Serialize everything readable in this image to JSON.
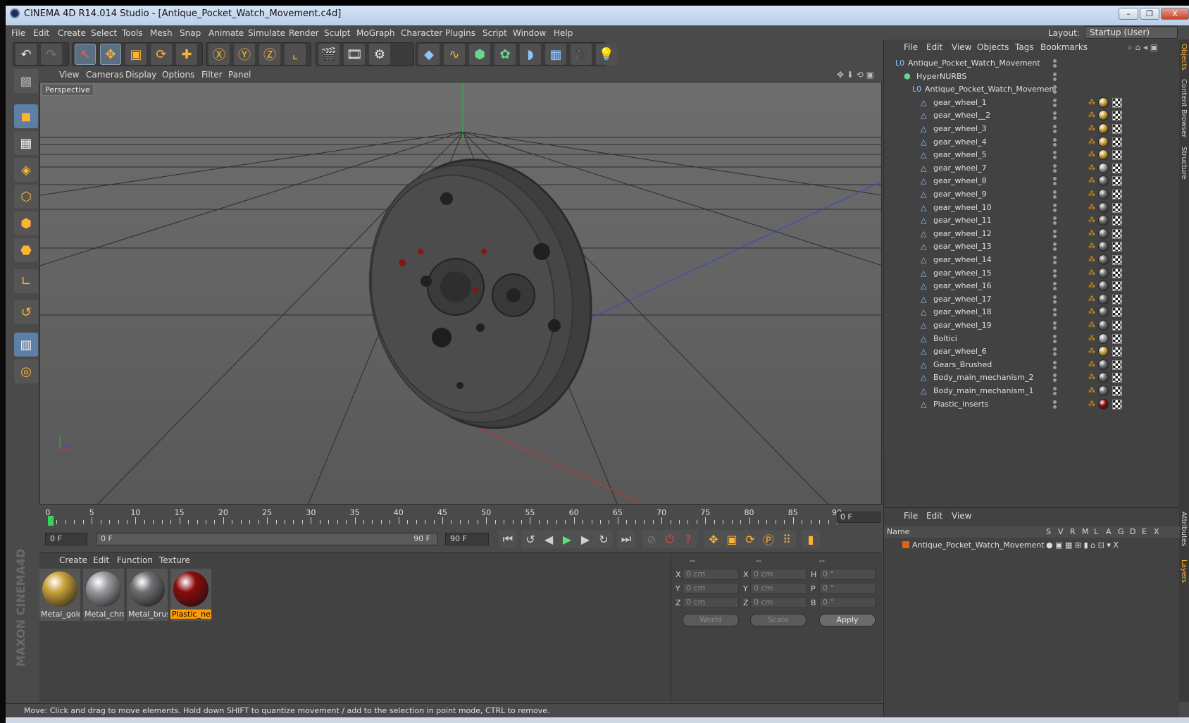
{
  "window": {
    "title": "CINEMA 4D R14.014 Studio - [Antique_Pocket_Watch_Movement.c4d]",
    "min": "–",
    "max": "❐",
    "close": "X"
  },
  "menu": [
    "File",
    "Edit",
    "Create",
    "Select",
    "Tools",
    "Mesh",
    "Snap",
    "Animate",
    "Simulate",
    "Render",
    "Sculpt",
    "MoGraph",
    "Character",
    "Plugins",
    "Script",
    "Window",
    "Help"
  ],
  "layout": {
    "label": "Layout:",
    "value": "Startup (User)"
  },
  "viewport": {
    "menu": [
      "View",
      "Cameras",
      "Display",
      "Options",
      "Filter",
      "Panel"
    ],
    "label": "Perspective"
  },
  "timeline": {
    "ticks": [
      "0",
      "5",
      "10",
      "15",
      "20",
      "25",
      "30",
      "35",
      "40",
      "45",
      "50",
      "55",
      "60",
      "65",
      "70",
      "75",
      "80",
      "85",
      "90"
    ],
    "current": "0 F"
  },
  "transport": {
    "start": "0 F",
    "range_start": "0 F",
    "range_end": "90 F",
    "end": "90 F"
  },
  "materials": {
    "menu": [
      "Create",
      "Edit",
      "Function",
      "Texture"
    ],
    "items": [
      {
        "name": "Metal_gold",
        "color": "#c9a23a"
      },
      {
        "name": "Metal_chro",
        "color": "#9a9aa0"
      },
      {
        "name": "Metal_brus",
        "color": "#6f6f73"
      },
      {
        "name": "Plastic_new",
        "color": "#8a0b0b"
      }
    ]
  },
  "attributes": {
    "headers": [
      "--",
      "--",
      "--"
    ],
    "rows": [
      {
        "a": "X",
        "av": "0 cm",
        "b": "X",
        "bv": "0 cm",
        "c": "H",
        "cv": "0 °"
      },
      {
        "a": "Y",
        "av": "0 cm",
        "b": "Y",
        "bv": "0 cm",
        "c": "P",
        "cv": "0 °"
      },
      {
        "a": "Z",
        "av": "0 cm",
        "b": "Z",
        "bv": "0 cm",
        "c": "B",
        "cv": "0 °"
      }
    ],
    "coord": "World",
    "mode": "Scale",
    "apply": "Apply"
  },
  "status": "Move: Click and drag to move elements. Hold down SHIFT to quantize movement / add to the selection in point mode, CTRL to remove.",
  "objects": {
    "menu": [
      "File",
      "Edit",
      "View",
      "Objects",
      "Tags",
      "Bookmarks"
    ],
    "items": [
      {
        "name": "Antique_Pocket_Watch_Movement",
        "level": 0,
        "kind": "null"
      },
      {
        "name": "HyperNURBS",
        "level": 1,
        "kind": "nurbs"
      },
      {
        "name": "Antique_Pocket_Watch_Movement",
        "level": 2,
        "kind": "null"
      },
      {
        "name": "gear_wheel_1",
        "level": 3,
        "kind": "mesh",
        "mat": "#c9a23a"
      },
      {
        "name": "gear_wheel__2",
        "level": 3,
        "kind": "mesh",
        "mat": "#c9a23a"
      },
      {
        "name": "gear_wheel_3",
        "level": 3,
        "kind": "mesh",
        "mat": "#c9a23a"
      },
      {
        "name": "gear_wheel_4",
        "level": 3,
        "kind": "mesh",
        "mat": "#c9a23a"
      },
      {
        "name": "gear_wheel_5",
        "level": 3,
        "kind": "mesh",
        "mat": "#c9a23a"
      },
      {
        "name": "gear_wheel_7",
        "level": 3,
        "kind": "mesh",
        "mat": "#9a9aa0"
      },
      {
        "name": "gear_wheel_8",
        "level": 3,
        "kind": "mesh",
        "mat": "#6f6f73"
      },
      {
        "name": "gear_wheel_9",
        "level": 3,
        "kind": "mesh",
        "mat": "#6f6f73"
      },
      {
        "name": "gear_wheel_10",
        "level": 3,
        "kind": "mesh",
        "mat": "#6f6f73"
      },
      {
        "name": "gear_wheel_11",
        "level": 3,
        "kind": "mesh",
        "mat": "#6f6f73"
      },
      {
        "name": "gear_wheel_12",
        "level": 3,
        "kind": "mesh",
        "mat": "#6f6f73"
      },
      {
        "name": "gear_wheel_13",
        "level": 3,
        "kind": "mesh",
        "mat": "#6f6f73"
      },
      {
        "name": "gear_wheel_14",
        "level": 3,
        "kind": "mesh",
        "mat": "#6f6f73"
      },
      {
        "name": "gear_wheel_15",
        "level": 3,
        "kind": "mesh",
        "mat": "#6f6f73"
      },
      {
        "name": "gear_wheel_16",
        "level": 3,
        "kind": "mesh",
        "mat": "#6f6f73"
      },
      {
        "name": "gear_wheel_17",
        "level": 3,
        "kind": "mesh",
        "mat": "#6f6f73"
      },
      {
        "name": "gear_wheel_18",
        "level": 3,
        "kind": "mesh",
        "mat": "#6f6f73"
      },
      {
        "name": "gear_wheel_19",
        "level": 3,
        "kind": "mesh",
        "mat": "#6f6f73"
      },
      {
        "name": "Boltici",
        "level": 3,
        "kind": "mesh",
        "mat": "#9a9aa0"
      },
      {
        "name": "gear_wheel_6",
        "level": 3,
        "kind": "mesh",
        "mat": "#c9a23a"
      },
      {
        "name": "Gears_Brushed",
        "level": 3,
        "kind": "mesh",
        "mat": "#6f6f73"
      },
      {
        "name": "Body_main_mechanism_2",
        "level": 3,
        "kind": "mesh",
        "mat": "#6f6f73"
      },
      {
        "name": "Body_main_mechanism_1",
        "level": 3,
        "kind": "mesh",
        "mat": "#6f6f73"
      },
      {
        "name": "Plastic_inserts",
        "level": 3,
        "kind": "mesh",
        "mat": "#8a0b0b"
      }
    ]
  },
  "layers": {
    "menu": [
      "File",
      "Edit",
      "View"
    ],
    "columns": [
      "Name",
      "S",
      "V",
      "R",
      "M",
      "L",
      "A",
      "G",
      "D",
      "E",
      "X"
    ],
    "row": "Antique_Pocket_Watch_Movement"
  },
  "sidetabs": [
    "Objects",
    "Content Browser",
    "Structure",
    "Attributes",
    "Layers"
  ],
  "colors": {
    "accent": "#ff9e00",
    "selection": "#5c7fa3"
  }
}
